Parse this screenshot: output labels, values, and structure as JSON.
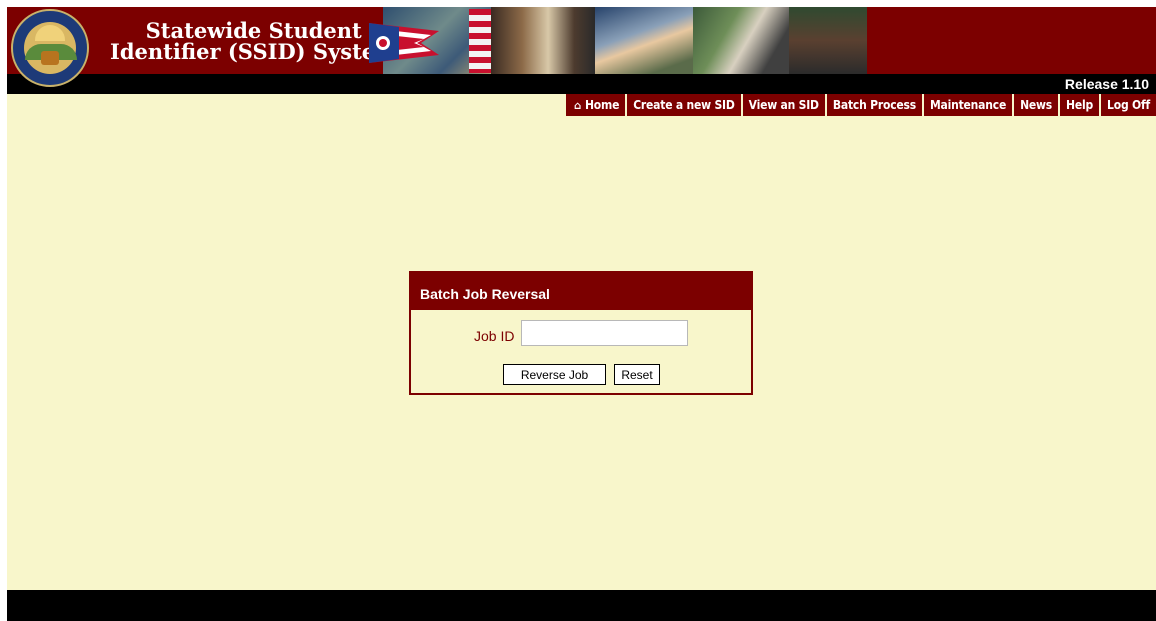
{
  "header": {
    "title_line1": "Statewide Student",
    "title_line2": "Identifier (SSID) System",
    "release": "Release 1.10"
  },
  "nav": {
    "home": "Home",
    "create": "Create a new SID",
    "view": "View an SID",
    "batch": "Batch Process",
    "maintenance": "Maintenance",
    "news": "News",
    "help": "Help",
    "logoff": "Log Off"
  },
  "panel": {
    "title": "Batch Job Reversal",
    "job_label": "Job ID",
    "job_value": "",
    "reverse_button": "Reverse Job",
    "reset_button": "Reset"
  },
  "colors": {
    "brand": "#7c0000",
    "page_background": "#f8f6cb",
    "bar": "#000000"
  },
  "icons": {
    "home": "home-icon",
    "seal": "ohio-seal",
    "flag": "ohio-flag"
  }
}
